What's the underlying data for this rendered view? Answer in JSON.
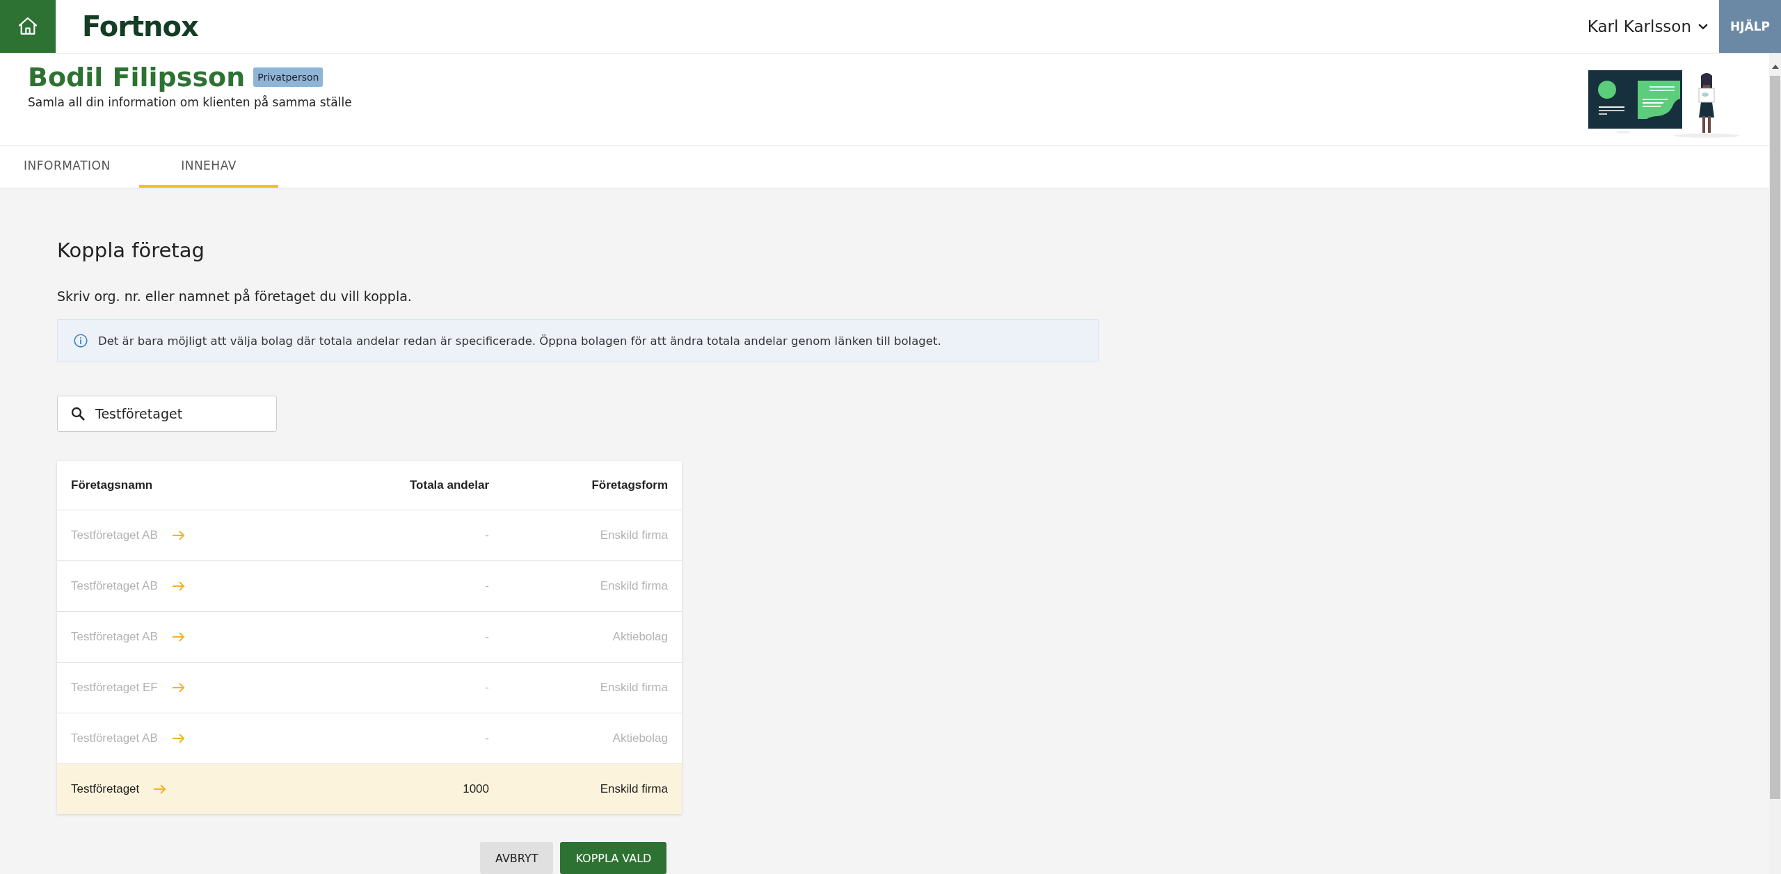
{
  "header": {
    "logo": "Fortnox",
    "user": "Karl Karlsson",
    "help": "HJÄLP"
  },
  "client": {
    "name": "Bodil Filipsson",
    "badge": "Privatperson",
    "subtitle": "Samla all din information om klienten på samma ställe"
  },
  "tabs": [
    {
      "label": "INFORMATION",
      "selected": false
    },
    {
      "label": "INNEHAV",
      "selected": true
    }
  ],
  "section": {
    "title": "Koppla företag",
    "instruction": "Skriv org. nr. eller namnet på företaget du vill koppla.",
    "info": "Det är bara möjligt att välja bolag där totala andelar redan är specificerade. Öppna bolagen för att ändra totala andelar genom länken till bolaget."
  },
  "search": {
    "value": "Testföretaget"
  },
  "table": {
    "columns": [
      "Företagsnamn",
      "Totala andelar",
      "Företagsform"
    ],
    "rows": [
      {
        "name": "Testföretaget AB",
        "shares": "-",
        "form": "Enskild firma",
        "disabled": true,
        "selected": false
      },
      {
        "name": "Testföretaget AB",
        "shares": "-",
        "form": "Enskild firma",
        "disabled": true,
        "selected": false
      },
      {
        "name": "Testföretaget AB",
        "shares": "-",
        "form": "Aktiebolag",
        "disabled": true,
        "selected": false
      },
      {
        "name": "Testföretaget EF",
        "shares": "-",
        "form": "Enskild firma",
        "disabled": true,
        "selected": false
      },
      {
        "name": "Testföretaget AB",
        "shares": "-",
        "form": "Aktiebolag",
        "disabled": true,
        "selected": false
      },
      {
        "name": "Testföretaget",
        "shares": "1000",
        "form": "Enskild firma",
        "disabled": false,
        "selected": true
      }
    ]
  },
  "buttons": [
    {
      "label": "AVBRYT",
      "kind": "secondary"
    },
    {
      "label": "KOPPLA VALD",
      "kind": "primary"
    }
  ]
}
